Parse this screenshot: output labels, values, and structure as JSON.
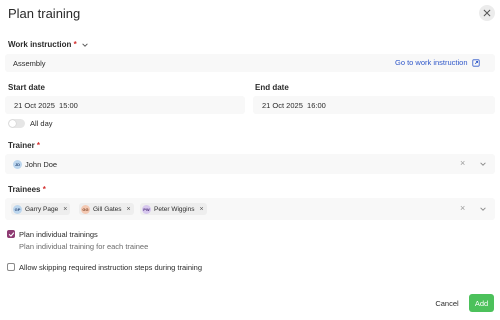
{
  "dialog": {
    "title": "Plan training"
  },
  "work_instruction": {
    "label": "Work instruction",
    "required_mark": "*",
    "value": "Assembly",
    "link_label": "Go to work instruction"
  },
  "start_date": {
    "label": "Start date",
    "value": "21 Oct 2025  15:00"
  },
  "end_date": {
    "label": "End date",
    "value": "21 Oct 2025  16:00"
  },
  "all_day": {
    "label": "All day",
    "checked": false
  },
  "trainer": {
    "label": "Trainer",
    "required_mark": "*",
    "initials": "JD",
    "name": "John Doe"
  },
  "trainees": {
    "label": "Trainees",
    "required_mark": "*",
    "chips": [
      {
        "initials": "GP",
        "name": "Garry Page",
        "color": "#bcd6ee"
      },
      {
        "initials": "GG",
        "name": "Gill Gates",
        "color": "#f4c9b3"
      },
      {
        "initials": "PW",
        "name": "Peter Wiggins",
        "color": "#d7c7ee"
      }
    ]
  },
  "individual": {
    "label": "Plan individual trainings",
    "hint": "Plan individual training for each trainee",
    "checked": true
  },
  "skip_steps": {
    "label": "Allow skipping required instruction steps during training",
    "checked": false
  },
  "actions": {
    "cancel": "Cancel",
    "add": "Add"
  },
  "colors": {
    "accent": "#8e3b73",
    "link": "#2f57c9",
    "primary_button": "#4cc15b",
    "required": "#d3302f"
  }
}
